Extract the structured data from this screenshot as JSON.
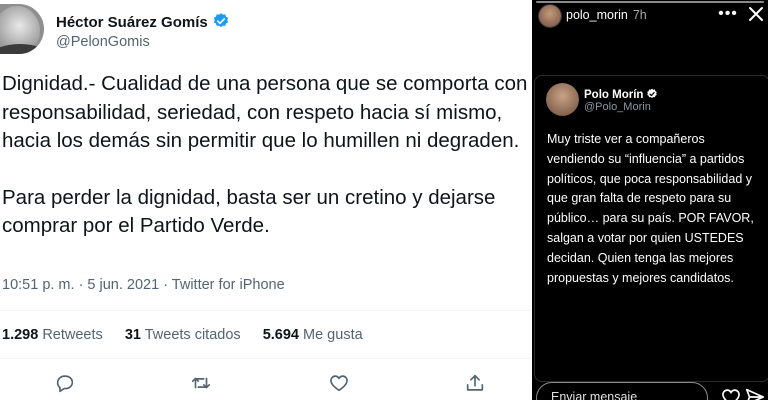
{
  "tweet": {
    "author_name": "Héctor Suárez Gomís",
    "author_handle": "@PelonGomis",
    "paragraphs": [
      "Dignidad.- Cualidad de una persona que se comporta con responsabilidad, seriedad, con respeto hacia sí mismo, hacia los demás sin permitir que lo humillen ni degraden.",
      "Para perder la dignidad, basta ser un cretino y dejarse comprar por el Partido Verde."
    ],
    "timestamp": "10:51 p. m. · 5 jun. 2021 · Twitter for iPhone",
    "stats": [
      {
        "count": "1.298",
        "label": "Retweets"
      },
      {
        "count": "31",
        "label": "Tweets citados"
      },
      {
        "count": "5.694",
        "label": "Me gusta"
      }
    ],
    "actions": [
      "reply-icon",
      "retweet-icon",
      "like-icon",
      "share-icon"
    ]
  },
  "story": {
    "username": "polo_morin",
    "time": "7h",
    "more_label": "•••",
    "card": {
      "name": "Polo Morín",
      "handle": "@Polo_Morin",
      "text": "Muy triste ver a compañeros vendiendo su “influencia” a partidos políticos, que poca responsabilidad y que gran falta de respeto para su público… para su país. POR FAVOR, salgan a votar por quien USTEDES decidan. Quien tenga las mejores propuestas y mejores candidatos."
    },
    "reply_placeholder": "Enviar mensaje"
  },
  "colors": {
    "verified_blue": "#1d9bf0",
    "tweet_text": "#0f1419",
    "tweet_secondary": "#536471",
    "story_background": "#000000"
  }
}
